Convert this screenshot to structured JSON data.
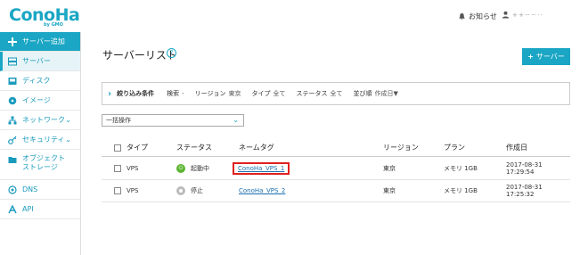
{
  "header": {
    "logo": "ConoHa",
    "logo_sub": "by GMO",
    "notice": "お知らせ",
    "user_name": "+ + ··· ··· · ·"
  },
  "sidebar": {
    "items": [
      {
        "label": "サーバー追加",
        "icon": "plus-icon"
      },
      {
        "label": "サーバー",
        "icon": "server-icon"
      },
      {
        "label": "ディスク",
        "icon": "disk-icon"
      },
      {
        "label": "イメージ",
        "icon": "image-icon"
      },
      {
        "label": "ネットワーク",
        "icon": "network-icon"
      },
      {
        "label": "セキュリティ",
        "icon": "key-icon"
      },
      {
        "label": "オブジェクト",
        "label2": "ストレージ",
        "icon": "folder-icon"
      },
      {
        "label": "DNS",
        "icon": "dns-icon"
      },
      {
        "label": "API",
        "icon": "api-icon"
      }
    ]
  },
  "main": {
    "title": "サーバーリスト",
    "help": "?",
    "add_button": "サーバー",
    "filter": {
      "title": "絞り込み条件",
      "fields": [
        {
          "key": "検索",
          "value": "-"
        },
        {
          "key": "リージョン",
          "value": "東京"
        },
        {
          "key": "タイプ",
          "value": "全て"
        },
        {
          "key": "ステータス",
          "value": "全て"
        },
        {
          "key": "並び順",
          "value": "作成日▼"
        }
      ]
    },
    "bulk": "一括操作",
    "table": {
      "headers": [
        "タイプ",
        "ステータス",
        "ネームタグ",
        "リージョン",
        "プラン",
        "作成日"
      ],
      "rows": [
        {
          "type": "VPS",
          "status": "起動中",
          "name": "ConoHa_VPS_1",
          "region": "東京",
          "plan": "メモリ 1GB",
          "created": "2017-08-31 17:29:54"
        },
        {
          "type": "VPS",
          "status": "停止",
          "name": "ConoHa_VPS_2",
          "region": "東京",
          "plan": "メモリ 1GB",
          "created": "2017-08-31 17:25:32"
        }
      ]
    }
  },
  "colors": {
    "accent": "#1aa6c4",
    "running": "#5cb531",
    "stopped": "#bbbbbb",
    "highlight": "#e02020"
  }
}
